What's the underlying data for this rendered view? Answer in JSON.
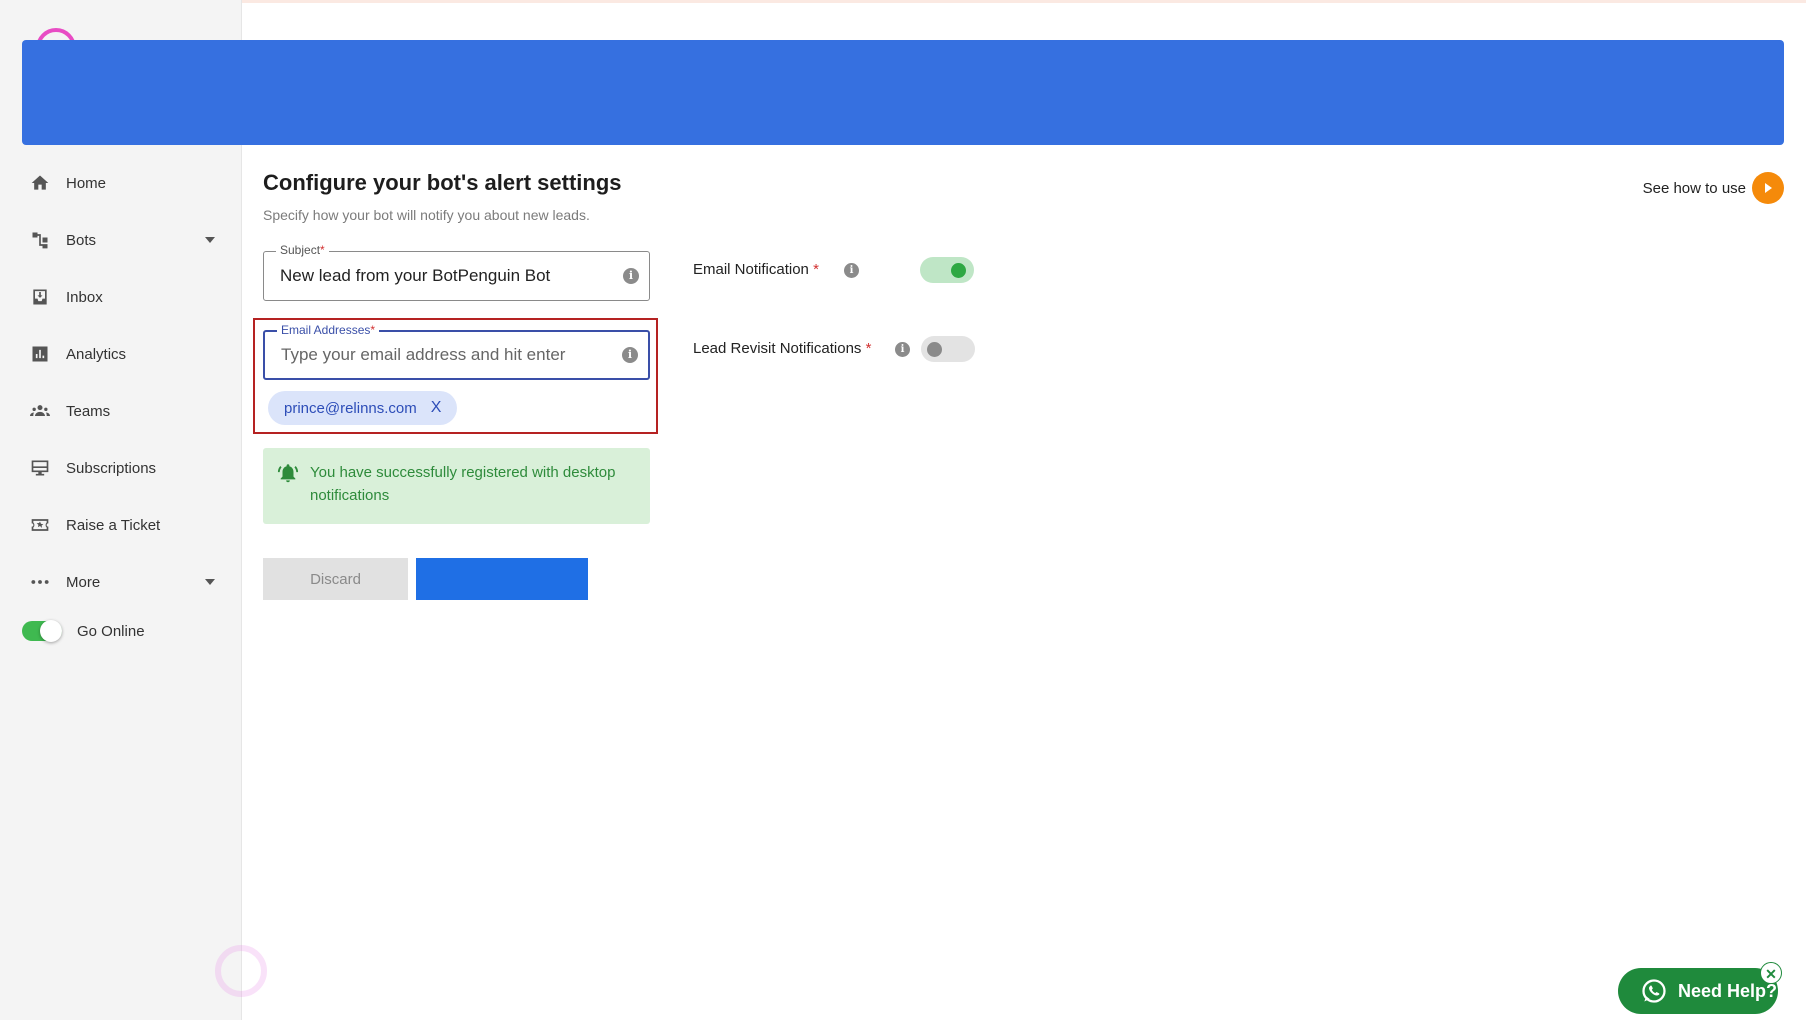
{
  "sidebar": {
    "items": [
      {
        "label": "Home",
        "icon": "home-icon"
      },
      {
        "label": "Bots",
        "icon": "bots-icon",
        "has_dropdown": true
      },
      {
        "label": "Inbox",
        "icon": "inbox-icon"
      },
      {
        "label": "Analytics",
        "icon": "analytics-icon"
      },
      {
        "label": "Teams",
        "icon": "teams-icon"
      },
      {
        "label": "Subscriptions",
        "icon": "subscriptions-icon"
      },
      {
        "label": "Raise a Ticket",
        "icon": "ticket-icon"
      },
      {
        "label": "More",
        "icon": "more-icon",
        "has_dropdown": true
      }
    ],
    "go_online_label": "Go Online",
    "go_online_enabled": true
  },
  "header": {
    "banner_color": "#3670e0"
  },
  "main": {
    "title": "Configure your bot's alert settings",
    "subtitle": "Specify how your bot will notify you about new leads.",
    "see_how_label": "See how to use",
    "subject": {
      "label": "Subject",
      "required_mark": "*",
      "value": "New lead from your BotPenguin Bot"
    },
    "email": {
      "label": "Email Addresses",
      "required_mark": "*",
      "placeholder": "Type your email address and hit enter",
      "chips": [
        {
          "text": "prince@relinns.com",
          "remove": "X"
        }
      ]
    },
    "success_message": "You have successfully registered with desktop notifications",
    "discard_label": "Discard",
    "save_label": ""
  },
  "settings": {
    "email_notification": {
      "label": "Email Notification",
      "required_mark": "*",
      "enabled": true
    },
    "lead_revisit": {
      "label": "Lead Revisit Notifications",
      "required_mark": "*",
      "enabled": false
    }
  },
  "help_widget": {
    "label": "Need Help?",
    "close": "✕"
  },
  "colors": {
    "accent_blue": "#1f6fe5",
    "success_green": "#2e8b3b",
    "highlight_red": "#b52222",
    "whatsapp_green": "#1f8a3c",
    "play_orange": "#f58a0a"
  }
}
